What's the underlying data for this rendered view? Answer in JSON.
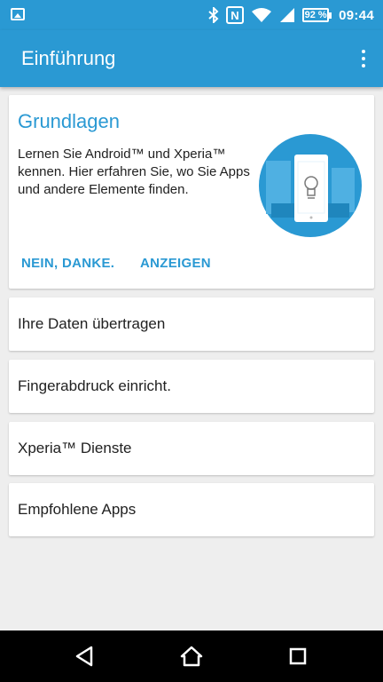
{
  "status_bar": {
    "icons": [
      "image-icon",
      "bluetooth-icon",
      "nfc-icon",
      "wifi-icon",
      "cell-signal-icon",
      "battery-icon"
    ],
    "nfc_letter": "N",
    "battery_percent": "92 %",
    "time": "09:44"
  },
  "app_bar": {
    "title": "Einführung",
    "menu_icon": "more-vert-icon"
  },
  "intro_card": {
    "title": "Grundlagen",
    "body": "Lernen Sie Android™ und Xperia™ kennen. Hier erfahren Sie, wo Sie Apps und andere Elemente finden.",
    "illustration": "phone-lightbulb-illustration",
    "dismiss_label": "NEIN, DANKE.",
    "show_label": "ANZEIGEN"
  },
  "list_items": [
    {
      "label": "Ihre Daten übertragen"
    },
    {
      "label": "Fingerabdruck einricht."
    },
    {
      "label": "Xperia™ Dienste"
    },
    {
      "label": "Empfohlene Apps"
    }
  ],
  "nav_bar": {
    "icons": [
      "back-icon",
      "home-icon",
      "recents-icon"
    ]
  },
  "colors": {
    "accent": "#2a99d3",
    "background": "#eeeeee",
    "card": "#ffffff",
    "nav_bar": "#000000",
    "text_primary": "#212121"
  }
}
